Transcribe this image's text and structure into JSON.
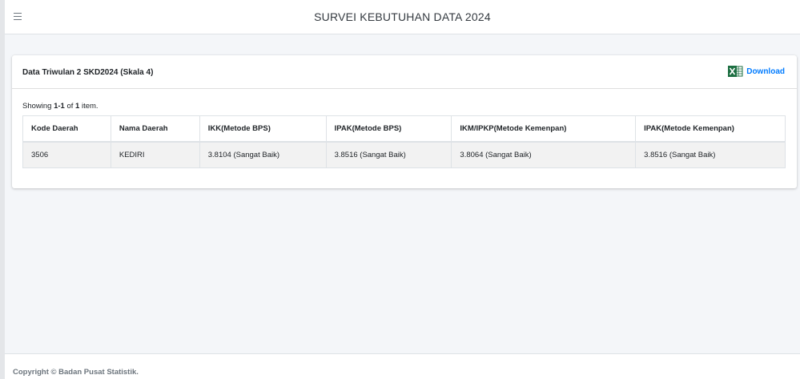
{
  "header": {
    "title": "SURVEI KEBUTUHAN DATA 2024"
  },
  "card": {
    "title": "Data Triwulan 2 SKD2024 (Skala 4)",
    "download_label": "Download",
    "summary": {
      "prefix": "Showing ",
      "range": "1-1",
      "middle": " of ",
      "total": "1",
      "suffix": " item."
    }
  },
  "table": {
    "columns": [
      "Kode Daerah",
      "Nama Daerah",
      "IKK(Metode BPS)",
      "IPAK(Metode BPS)",
      "IKM/IPKP(Metode Kemenpan)",
      "IPAK(Metode Kemenpan)"
    ],
    "rows": [
      [
        "3506",
        "KEDIRI",
        "3.8104 (Sangat Baik)",
        "3.8516 (Sangat Baik)",
        "3.8064 (Sangat Baik)",
        "3.8516 (Sangat Baik)"
      ]
    ]
  },
  "footer": {
    "copyright": "Copyright © Badan Pusat Statistik."
  },
  "colors": {
    "accent": "#007bff",
    "excel_green": "#1d6f42"
  },
  "icons": {
    "menu": "hamburger-icon",
    "download": "excel-icon"
  }
}
